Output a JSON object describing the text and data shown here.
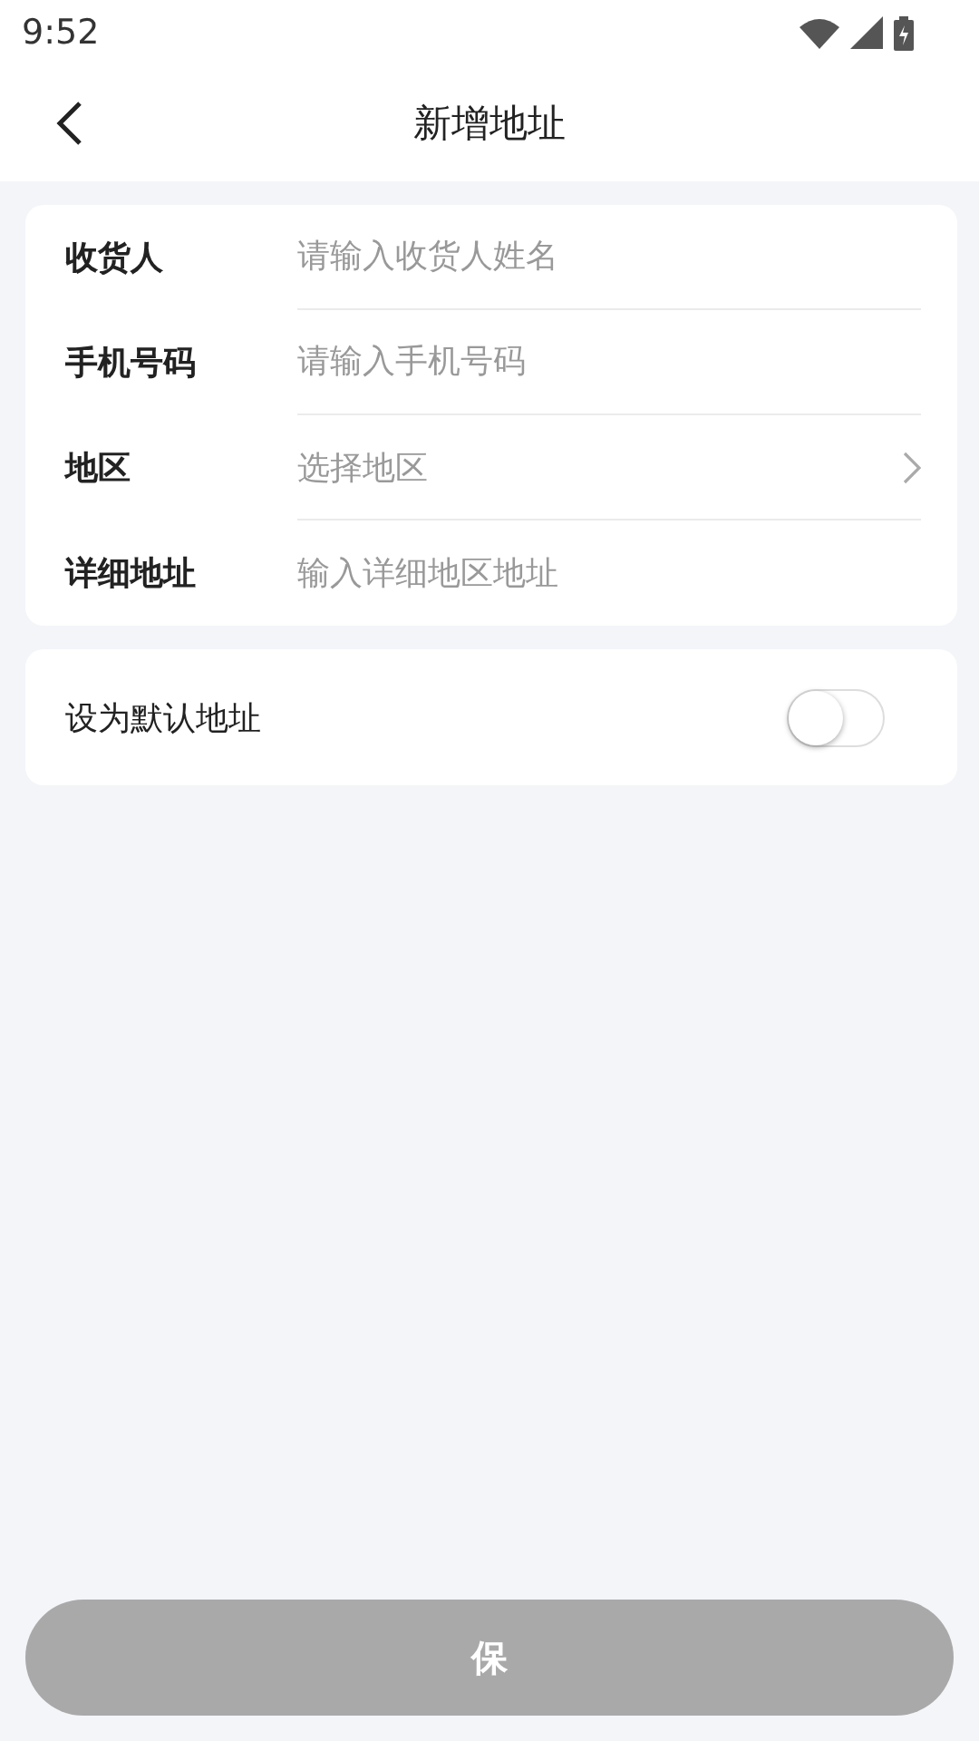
{
  "status_bar": {
    "time": "9:52"
  },
  "header": {
    "title": "新增地址"
  },
  "fields": [
    {
      "label": "收货人",
      "placeholder": "请输入收货人姓名",
      "kind": "input"
    },
    {
      "label": "手机号码",
      "placeholder": "请输入手机号码",
      "kind": "input"
    },
    {
      "label": "地区",
      "placeholder": "选择地区",
      "kind": "select"
    },
    {
      "label": "详细地址",
      "placeholder": "输入详细地区地址",
      "kind": "input"
    }
  ],
  "default_address": {
    "label": "设为默认地址",
    "on": false
  },
  "save_button": {
    "label": "保",
    "disabled": true
  }
}
